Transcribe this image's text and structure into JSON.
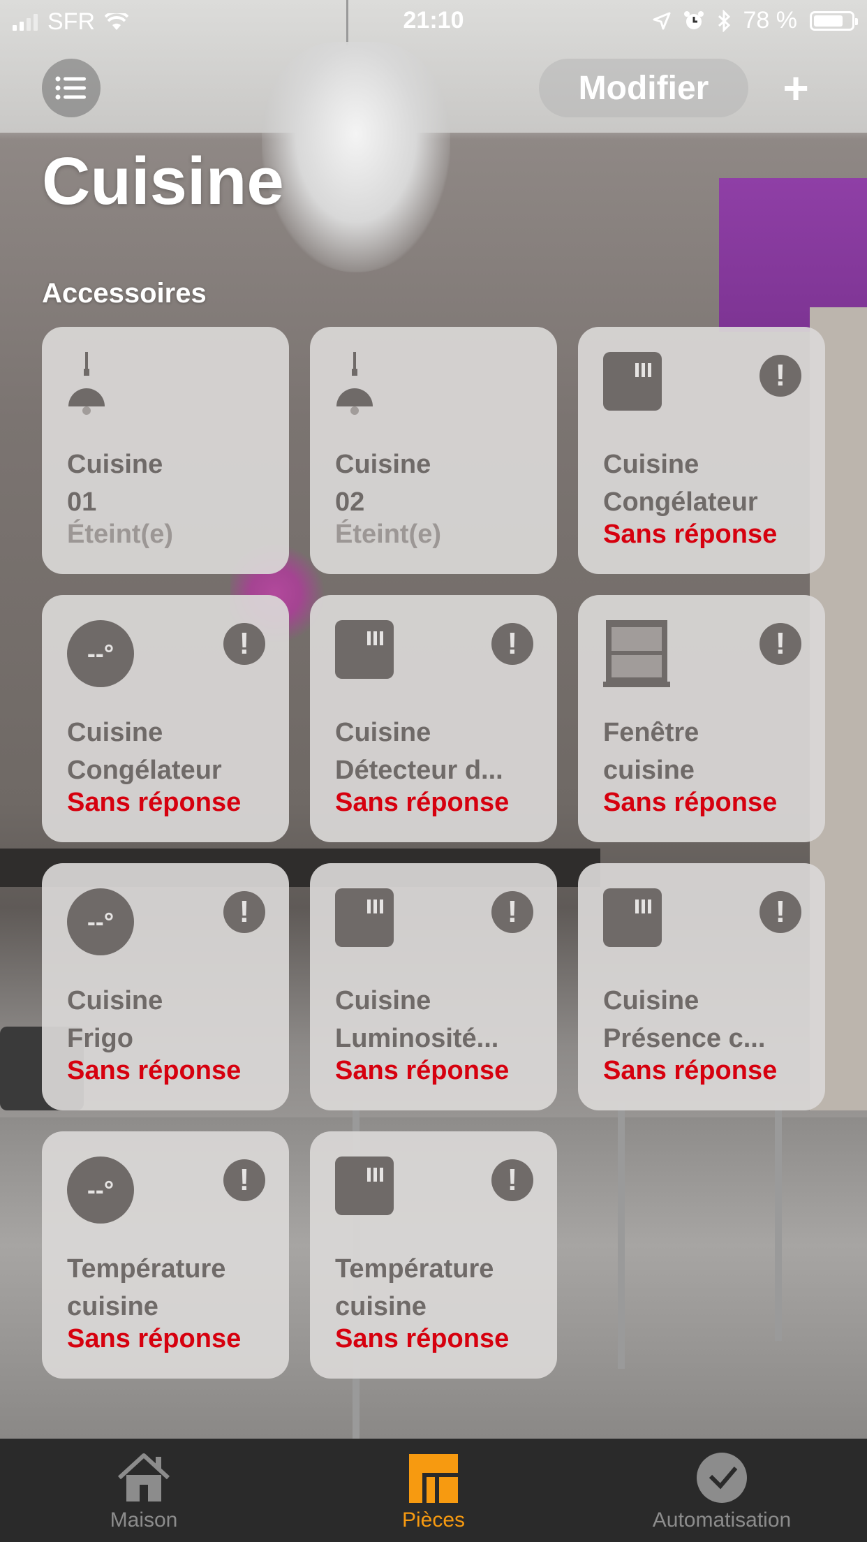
{
  "status_bar": {
    "carrier": "SFR",
    "time": "21:10",
    "battery": "78 %",
    "battery_level": 0.78
  },
  "nav": {
    "menu_icon": "list-icon",
    "edit_label": "Modifier",
    "add_label": "+"
  },
  "room": {
    "title": "Cuisine",
    "section_title": "Accessoires"
  },
  "accessories": [
    {
      "icon": "pendant-lamp-icon",
      "line1": "Cuisine",
      "line2": "01",
      "state": "Éteint(e)",
      "alert": false
    },
    {
      "icon": "pendant-lamp-icon",
      "line1": "Cuisine",
      "line2": "02",
      "state": "Éteint(e)",
      "alert": false
    },
    {
      "icon": "sensor-icon",
      "line1": "Cuisine",
      "line2": "Congélateur",
      "state": "Sans réponse",
      "alert": true
    },
    {
      "icon": "thermometer-icon",
      "icon_text": "--°",
      "line1": "Cuisine",
      "line2": "Congélateur",
      "state": "Sans réponse",
      "alert": true
    },
    {
      "icon": "sensor-icon",
      "line1": "Cuisine",
      "line2": "Détecteur d...",
      "state": "Sans réponse",
      "alert": true
    },
    {
      "icon": "window-icon",
      "line1": "Fenêtre",
      "line2": "cuisine",
      "state": "Sans réponse",
      "alert": true
    },
    {
      "icon": "thermometer-icon",
      "icon_text": "--°",
      "line1": "Cuisine",
      "line2": "Frigo",
      "state": "Sans réponse",
      "alert": true
    },
    {
      "icon": "sensor-icon",
      "line1": "Cuisine",
      "line2": "Luminosité...",
      "state": "Sans réponse",
      "alert": true
    },
    {
      "icon": "sensor-icon",
      "line1": "Cuisine",
      "line2": "Présence c...",
      "state": "Sans réponse",
      "alert": true
    },
    {
      "icon": "thermometer-icon",
      "icon_text": "--°",
      "line1": "Température",
      "line2": "cuisine",
      "state": "Sans réponse",
      "alert": true
    },
    {
      "icon": "sensor-icon",
      "line1": "Température",
      "line2": "cuisine",
      "state": "Sans réponse",
      "alert": true
    }
  ],
  "alert_glyph": "!",
  "tabs": [
    {
      "label": "Maison",
      "icon": "house-icon",
      "active": false
    },
    {
      "label": "Pièces",
      "icon": "rooms-icon",
      "active": true
    },
    {
      "label": "Automatisation",
      "icon": "clock-check-icon",
      "active": false
    }
  ],
  "colors": {
    "accent": "#f79a10",
    "error": "#d6000e",
    "tile_text": "#6f6a68"
  }
}
